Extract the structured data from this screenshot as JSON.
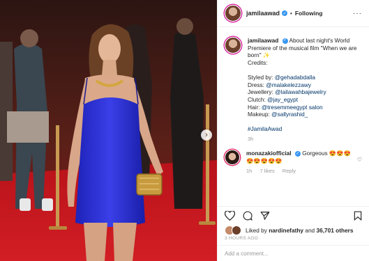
{
  "post": {
    "username": "jamilaawad",
    "follow_status": "Following",
    "caption_lines": [
      "About last night's World Premiere of the musical film \"When we are born\" ✨",
      "Credits:"
    ],
    "credits": [
      {
        "label": "Styled by:",
        "handle": "@gehadabdalla"
      },
      {
        "label": "Dress:",
        "handle": "@malakelezzawy"
      },
      {
        "label": "Jewellery:",
        "handle": "@lailawahbajewelry"
      },
      {
        "label": "Clutch:",
        "handle": "@jay_egypt"
      },
      {
        "label": "Hair:",
        "handle": "@tresemmeegypt salon"
      },
      {
        "label": "Makeup:",
        "handle": "@sallyrashid_"
      }
    ],
    "hashtag": "#JamilaAwad",
    "caption_age": "3h"
  },
  "comment": {
    "username": "monazakiofficial",
    "text": "Gorgeous 😍😍😍😍😍😍😍😍",
    "age": "1h",
    "likes": "7 likes",
    "reply": "Reply"
  },
  "liked_by": {
    "prefix": "Liked by",
    "user": "nardinefathy",
    "middle": "and",
    "count": "36,701 others"
  },
  "timestamp": "3 HOURS AGO",
  "add_comment_placeholder": "Add a comment...",
  "icons": [
    "more-icon",
    "verified-icon",
    "heart-icon",
    "comment-icon",
    "share-icon",
    "bookmark-icon",
    "chevron-right-icon"
  ],
  "colors": {
    "verified": "#3897f0",
    "link": "#003569",
    "meta": "#999999",
    "dress": "#2a2fd6",
    "carpet": "#b8121a"
  }
}
